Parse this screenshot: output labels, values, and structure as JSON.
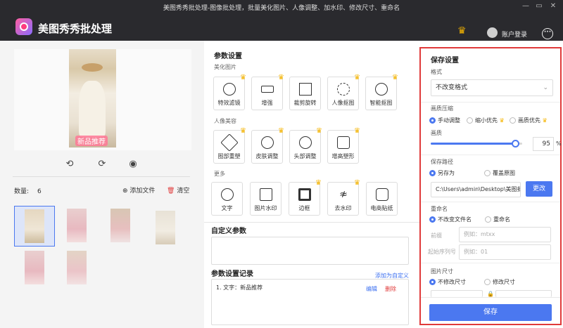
{
  "window": {
    "title": "美图秀秀批处理-图像批处理，批量美化图片、人像调整、加水印、修改尺寸、重命名"
  },
  "header": {
    "app_name": "美图秀秀批处理",
    "login": "账户登录"
  },
  "preview": {
    "tag": "新品推荐"
  },
  "files": {
    "count_label": "数量:",
    "count": "6",
    "add_label": "添加文件",
    "clear_label": "清空"
  },
  "params": {
    "title": "参数设置",
    "beautify_title": "美化图片",
    "beautify": [
      "特效滤镜",
      "增强",
      "裁剪旋转",
      "人像抠图",
      "智能抠图"
    ],
    "portrait_title": "人像美容",
    "portrait": [
      "图部重塑",
      "皮肤调整",
      "头部调整",
      "增高塑形"
    ],
    "more_title": "更多",
    "more": [
      "文字",
      "图片水印",
      "边框",
      "去水印",
      "电商贴纸"
    ]
  },
  "custom": {
    "title": "自定义参数"
  },
  "records": {
    "title": "参数设置记录",
    "add_link": "添加为自定义",
    "item": "1. 文字：新品推荐",
    "edit": "编辑",
    "delete": "删除"
  },
  "save": {
    "title": "保存设置",
    "format_label": "格式",
    "format_value": "不改变格式",
    "compress_label": "画质压缩",
    "compress_options": [
      "手动调整",
      "缩小优先",
      "画质优先"
    ],
    "quality_label": "画质",
    "quality": "95",
    "quality_unit": "%",
    "path_label": "保存路径",
    "path_options": [
      "另存为",
      "覆盖原图"
    ],
    "path_value": "C:\\Users\\admin\\Desktop\\美图批处",
    "change_button": "更改",
    "rename_label": "重命名",
    "rename_options": [
      "不改变文件名",
      "重命名"
    ],
    "prefix_label": "前缀",
    "prefix_placeholder": "例如：mtxx",
    "seq_label": "起始序列号",
    "seq_placeholder": "例如：01",
    "size_label": "图片尺寸",
    "size_options": [
      "不修改尺寸",
      "修改尺寸"
    ],
    "save_button": "保存"
  },
  "colors": {
    "accent": "#4b78f0",
    "highlight": "#e03a3a",
    "crown": "#f5b400"
  }
}
